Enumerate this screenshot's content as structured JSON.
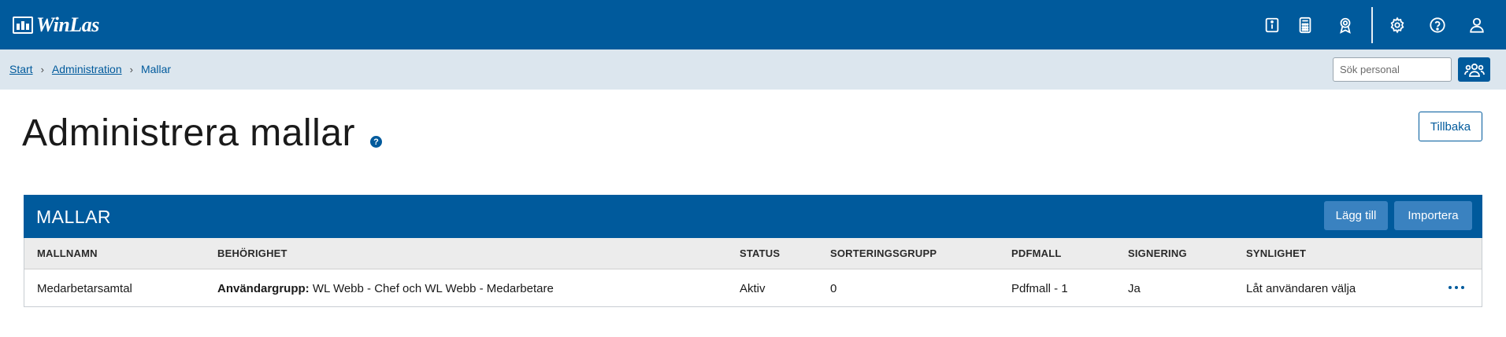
{
  "app": {
    "logo_text": "WinLas"
  },
  "topbar": {
    "icons": [
      "info-icon",
      "calculator-icon",
      "award-icon",
      "gear-icon",
      "help-icon",
      "user-icon"
    ]
  },
  "breadcrumb": {
    "items": [
      {
        "label": "Start"
      },
      {
        "label": "Administration"
      },
      {
        "label": "Mallar"
      }
    ],
    "separator": "›"
  },
  "search": {
    "placeholder": "Sök personal",
    "value": ""
  },
  "page": {
    "title": "Administrera mallar",
    "help_glyph": "?",
    "back_label": "Tillbaka"
  },
  "panel": {
    "title": "MALLAR",
    "add_label": "Lägg till",
    "import_label": "Importera",
    "columns": [
      "MALLNAMN",
      "BEHÖRIGHET",
      "STATUS",
      "SORTERINGSGRUPP",
      "PDFMALL",
      "SIGNERING",
      "SYNLIGHET"
    ],
    "rows": [
      {
        "name": "Medarbetarsamtal",
        "permission_label": "Användargrupp:",
        "permission_value": "WL Webb - Chef och WL Webb - Medarbetare",
        "status": "Aktiv",
        "sort_group": "0",
        "pdf_template": "Pdfmall - 1",
        "signing": "Ja",
        "visibility": "Låt användaren välja"
      }
    ]
  },
  "colors": {
    "primary": "#005a9c",
    "crumb_bg": "#dce6ee",
    "button_light": "#3a82c0"
  }
}
